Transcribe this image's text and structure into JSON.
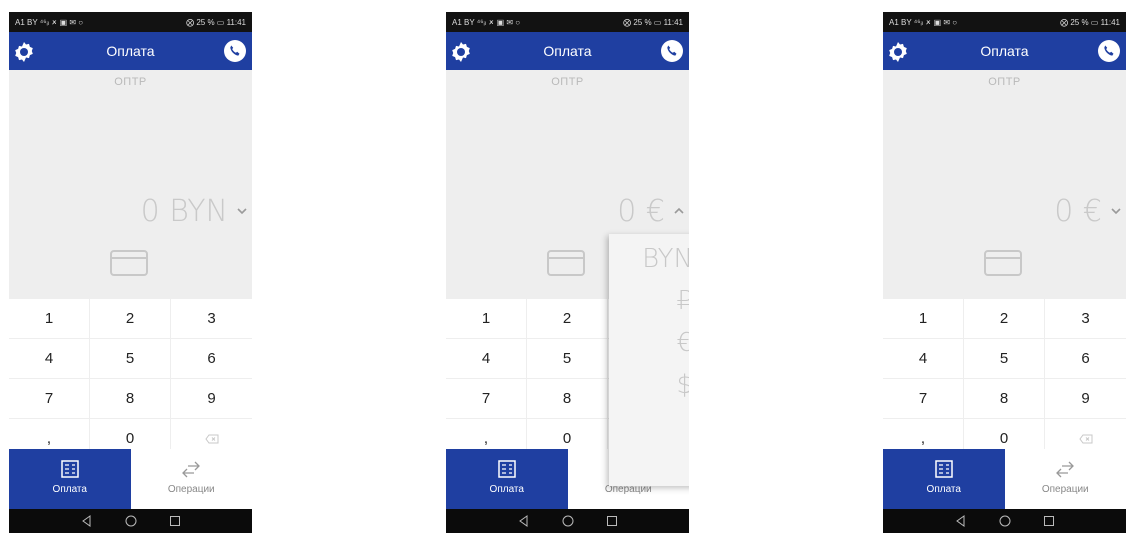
{
  "status_bar": {
    "left": "A1 BY ⁴⁶ᵢₗ 🗶 ▣ ✉ ○",
    "right": "⨂ 25 % ▭ 11:41"
  },
  "app_bar": {
    "title": "Оплата"
  },
  "terminal_label": "ОПТР",
  "screens": [
    {
      "amount": "0 BYN",
      "dropdown_open": false
    },
    {
      "amount": "0 €",
      "dropdown_open": true
    },
    {
      "amount": "0 €",
      "dropdown_open": false
    }
  ],
  "keypad": [
    "1",
    "2",
    "3",
    "4",
    "5",
    "6",
    "7",
    "8",
    "9",
    ",",
    "0"
  ],
  "nav": {
    "pay_label": "Оплата",
    "operations_label": "Операции"
  },
  "currency_options": [
    "BYN",
    "₽",
    "€",
    "$"
  ],
  "colors": {
    "accent": "#1f3fa1",
    "background_gray": "#eeeeee"
  }
}
